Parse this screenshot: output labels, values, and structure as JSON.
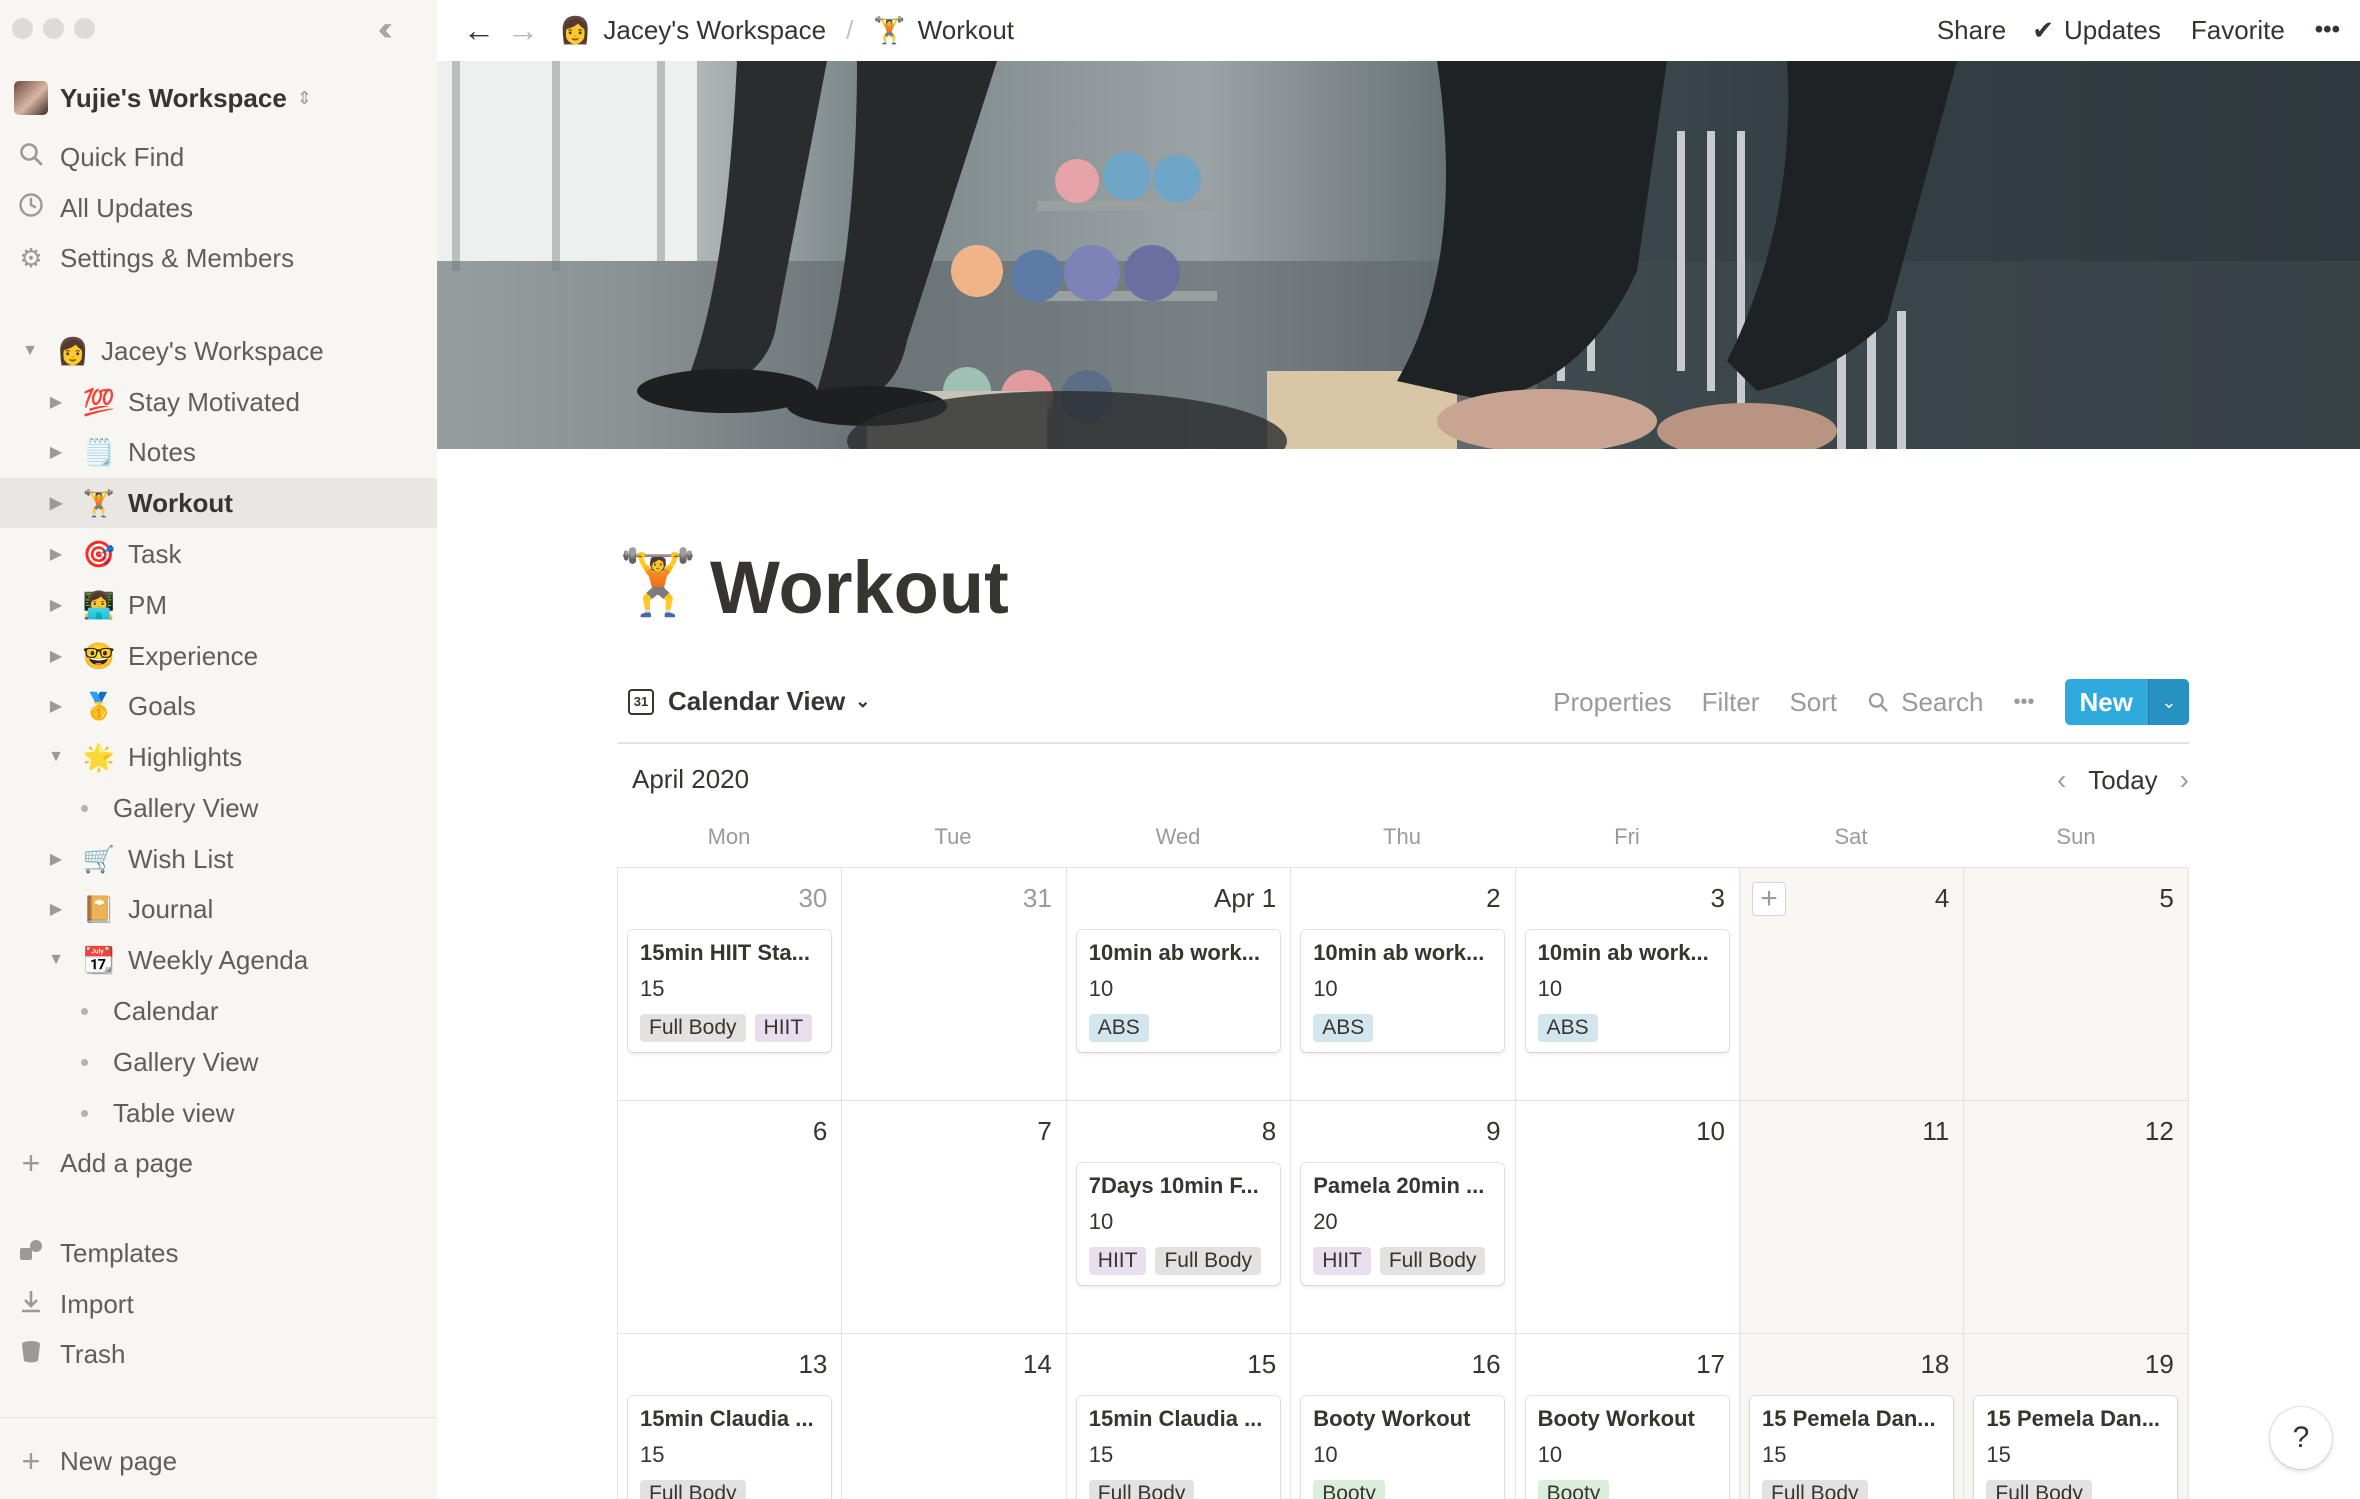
{
  "sidebar": {
    "workspace_name": "Yujie's Workspace",
    "nav": [
      {
        "icon": "search-icon",
        "label": "Quick Find"
      },
      {
        "icon": "clock-icon",
        "label": "All Updates"
      },
      {
        "icon": "gear-icon",
        "label": "Settings & Members"
      }
    ],
    "tree": [
      {
        "label": "Jacey's Workspace",
        "emoji": "👩",
        "expanded": true
      },
      {
        "label": "Stay Motivated",
        "emoji": "💯"
      },
      {
        "label": "Notes",
        "emoji": "🗒️"
      },
      {
        "label": "Workout",
        "emoji": "🏋️",
        "active": true
      },
      {
        "label": "Task",
        "emoji": "🎯"
      },
      {
        "label": "PM",
        "emoji": "👩‍💻"
      },
      {
        "label": "Experience",
        "emoji": "🤓"
      },
      {
        "label": "Goals",
        "emoji": "🥇"
      },
      {
        "label": "Highlights",
        "emoji": "🌟",
        "expanded": true
      },
      {
        "label": "Gallery View"
      },
      {
        "label": "Wish List",
        "emoji": "🛒"
      },
      {
        "label": "Journal",
        "emoji": "📔"
      },
      {
        "label": "Weekly Agenda",
        "emoji": "📆",
        "expanded": true
      },
      {
        "label": "Calendar"
      },
      {
        "label": "Gallery View"
      },
      {
        "label": "Table view"
      }
    ],
    "add_page": "Add a page",
    "footer": [
      {
        "icon": "templates-icon",
        "label": "Templates"
      },
      {
        "icon": "import-icon",
        "label": "Import"
      },
      {
        "icon": "trash-icon",
        "label": "Trash"
      }
    ],
    "new_page": "New page"
  },
  "topbar": {
    "crumbs": [
      {
        "label": "Jacey's Workspace",
        "emoji": "👩"
      },
      {
        "label": "Workout",
        "emoji": "🏋️"
      }
    ],
    "share": "Share",
    "updates": "Updates",
    "favorite": "Favorite",
    "more": "•••"
  },
  "page": {
    "icon": "🏋️",
    "title": "Workout"
  },
  "view": {
    "name": "Calendar View",
    "actions": {
      "properties": "Properties",
      "filter": "Filter",
      "sort": "Sort",
      "search": "Search",
      "more": "•••"
    },
    "new_label": "New"
  },
  "calendar": {
    "month": "April 2020",
    "today": "Today",
    "weekdays": [
      "Mon",
      "Tue",
      "Wed",
      "Thu",
      "Fri",
      "Sat",
      "Sun"
    ],
    "weeks": [
      [
        {
          "day": "30",
          "muted": true,
          "cards": [
            {
              "title": "15min HIIT Sta...",
              "value": "15",
              "tags": [
                {
                  "text": "Full Body",
                  "color": "gray"
                },
                {
                  "text": "HIIT",
                  "color": "purple"
                }
              ]
            }
          ]
        },
        {
          "day": "31",
          "muted": true,
          "cards": []
        },
        {
          "day": "Apr 1",
          "cards": [
            {
              "title": "10min ab work...",
              "value": "10",
              "tags": [
                {
                  "text": "ABS",
                  "color": "blue"
                }
              ]
            }
          ]
        },
        {
          "day": "2",
          "cards": [
            {
              "title": "10min ab work...",
              "value": "10",
              "tags": [
                {
                  "text": "ABS",
                  "color": "blue"
                }
              ]
            }
          ]
        },
        {
          "day": "3",
          "cards": [
            {
              "title": "10min ab work...",
              "value": "10",
              "tags": [
                {
                  "text": "ABS",
                  "color": "blue"
                }
              ]
            }
          ]
        },
        {
          "day": "4",
          "plus": "+",
          "cards": []
        },
        {
          "day": "5",
          "cards": []
        }
      ],
      [
        {
          "day": "6",
          "cards": []
        },
        {
          "day": "7",
          "cards": []
        },
        {
          "day": "8",
          "cards": [
            {
              "title": "7Days 10min F...",
              "value": "10",
              "tags": [
                {
                  "text": "HIIT",
                  "color": "purple"
                },
                {
                  "text": "Full Body",
                  "color": "gray"
                }
              ]
            }
          ]
        },
        {
          "day": "9",
          "cards": [
            {
              "title": "Pamela 20min ...",
              "value": "20",
              "tags": [
                {
                  "text": "HIIT",
                  "color": "purple"
                },
                {
                  "text": "Full Body",
                  "color": "gray"
                }
              ]
            }
          ]
        },
        {
          "day": "10",
          "cards": []
        },
        {
          "day": "11",
          "cards": []
        },
        {
          "day": "12",
          "cards": []
        }
      ],
      [
        {
          "day": "13",
          "cards": [
            {
              "title": "15min Claudia ...",
              "value": "15",
              "tags": [
                {
                  "text": "Full Body",
                  "color": "gray"
                }
              ]
            }
          ]
        },
        {
          "day": "14",
          "cards": []
        },
        {
          "day": "15",
          "cards": [
            {
              "title": "15min Claudia ...",
              "value": "15",
              "tags": [
                {
                  "text": "Full Body",
                  "color": "gray"
                }
              ]
            }
          ]
        },
        {
          "day": "16",
          "cards": [
            {
              "title": "Booty Workout",
              "value": "10",
              "tags": [
                {
                  "text": "Booty",
                  "color": "green"
                }
              ]
            }
          ]
        },
        {
          "day": "17",
          "cards": [
            {
              "title": "Booty Workout",
              "value": "10",
              "tags": [
                {
                  "text": "Booty",
                  "color": "green"
                }
              ]
            }
          ]
        },
        {
          "day": "18",
          "cards": [
            {
              "title": "15 Pemela Dan...",
              "value": "15",
              "tags": [
                {
                  "text": "Full Body",
                  "color": "gray"
                }
              ]
            }
          ]
        },
        {
          "day": "19",
          "cards": [
            {
              "title": "15 Pemela Dan...",
              "value": "15",
              "tags": [
                {
                  "text": "Full Body",
                  "color": "gray"
                }
              ]
            }
          ]
        }
      ]
    ]
  },
  "help": "?",
  "colors": {
    "accent": "#2eaadc",
    "sidebar_bg": "#f7f6f3",
    "text": "#37352f"
  }
}
